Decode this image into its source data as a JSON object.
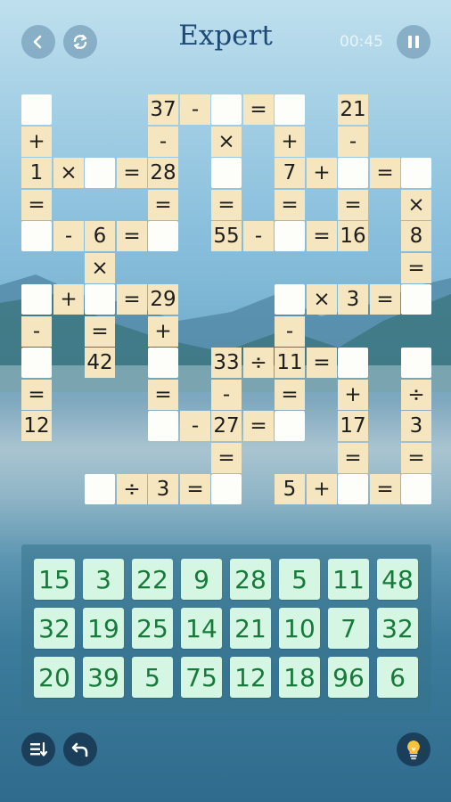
{
  "header": {
    "title": "Expert",
    "timer": "00:45",
    "back_icon": "chevron-left-icon",
    "restart_icon": "refresh-icon",
    "pause_icon": "pause-icon"
  },
  "board": {
    "cells": [
      {
        "id": "c_1_1",
        "t": "blank"
      },
      {
        "id": "c_2_1",
        "t": "op",
        "v": "+"
      },
      {
        "id": "c_3_1",
        "t": "num",
        "v": "1"
      },
      {
        "id": "c_3_2",
        "t": "op",
        "v": "×"
      },
      {
        "id": "c_3_3",
        "t": "blank"
      },
      {
        "id": "c_3_4",
        "t": "op",
        "v": "="
      },
      {
        "id": "c_3_5",
        "t": "num",
        "v": "28"
      },
      {
        "id": "c_1_5",
        "t": "num",
        "v": "37"
      },
      {
        "id": "c_1_6",
        "t": "op",
        "v": "-"
      },
      {
        "id": "c_1_7",
        "t": "blank"
      },
      {
        "id": "c_1_8",
        "t": "op",
        "v": "="
      },
      {
        "id": "c_1_9",
        "t": "blank"
      },
      {
        "id": "c_2_5",
        "t": "op",
        "v": "-"
      },
      {
        "id": "c_2_7",
        "t": "op",
        "v": "×"
      },
      {
        "id": "c_2_9",
        "t": "op",
        "v": "+"
      },
      {
        "id": "c_1_11",
        "t": "num",
        "v": "21"
      },
      {
        "id": "c_2_11",
        "t": "op",
        "v": "-"
      },
      {
        "id": "c_3_7",
        "t": "blank"
      },
      {
        "id": "c_3_9",
        "t": "num",
        "v": "7"
      },
      {
        "id": "c_3_10",
        "t": "op",
        "v": "+"
      },
      {
        "id": "c_3_11",
        "t": "blank"
      },
      {
        "id": "c_3_12",
        "t": "op",
        "v": "="
      },
      {
        "id": "c_3_13",
        "t": "blank"
      },
      {
        "id": "c_4_1",
        "t": "op",
        "v": "="
      },
      {
        "id": "c_4_5",
        "t": "op",
        "v": "="
      },
      {
        "id": "c_4_7",
        "t": "op",
        "v": "="
      },
      {
        "id": "c_4_9",
        "t": "op",
        "v": "="
      },
      {
        "id": "c_4_11",
        "t": "op",
        "v": "="
      },
      {
        "id": "c_4_13",
        "t": "op",
        "v": "×"
      },
      {
        "id": "c_5_1",
        "t": "blank"
      },
      {
        "id": "c_5_2",
        "t": "op",
        "v": "-"
      },
      {
        "id": "c_5_3",
        "t": "num",
        "v": "6"
      },
      {
        "id": "c_5_4",
        "t": "op",
        "v": "="
      },
      {
        "id": "c_5_5",
        "t": "blank"
      },
      {
        "id": "c_5_7",
        "t": "num",
        "v": "55"
      },
      {
        "id": "c_5_8",
        "t": "op",
        "v": "-"
      },
      {
        "id": "c_5_9",
        "t": "blank"
      },
      {
        "id": "c_5_10",
        "t": "op",
        "v": "="
      },
      {
        "id": "c_5_11",
        "t": "num",
        "v": "16"
      },
      {
        "id": "c_5_13",
        "t": "num",
        "v": "8"
      },
      {
        "id": "c_6_3",
        "t": "op",
        "v": "×"
      },
      {
        "id": "c_6_13",
        "t": "op",
        "v": "="
      },
      {
        "id": "c_7_1",
        "t": "blank"
      },
      {
        "id": "c_7_2",
        "t": "op",
        "v": "+"
      },
      {
        "id": "c_7_3",
        "t": "blank"
      },
      {
        "id": "c_7_4",
        "t": "op",
        "v": "="
      },
      {
        "id": "c_7_5",
        "t": "num",
        "v": "29"
      },
      {
        "id": "c_7_9",
        "t": "blank"
      },
      {
        "id": "c_7_10",
        "t": "op",
        "v": "×"
      },
      {
        "id": "c_7_11",
        "t": "num",
        "v": "3"
      },
      {
        "id": "c_7_12",
        "t": "op",
        "v": "="
      },
      {
        "id": "c_7_13",
        "t": "blank"
      },
      {
        "id": "c_8_1",
        "t": "op",
        "v": "-"
      },
      {
        "id": "c_8_3",
        "t": "op",
        "v": "="
      },
      {
        "id": "c_8_5",
        "t": "op",
        "v": "+"
      },
      {
        "id": "c_8_9",
        "t": "op",
        "v": "-"
      },
      {
        "id": "c_9_1",
        "t": "blank"
      },
      {
        "id": "c_9_3",
        "t": "num",
        "v": "42"
      },
      {
        "id": "c_9_5",
        "t": "blank"
      },
      {
        "id": "c_9_7",
        "t": "num",
        "v": "33"
      },
      {
        "id": "c_9_8",
        "t": "op",
        "v": "÷"
      },
      {
        "id": "c_9_9",
        "t": "num",
        "v": "11"
      },
      {
        "id": "c_9_10",
        "t": "op",
        "v": "="
      },
      {
        "id": "c_9_11",
        "t": "blank"
      },
      {
        "id": "c_9_13",
        "t": "blank"
      },
      {
        "id": "c_10_1",
        "t": "op",
        "v": "="
      },
      {
        "id": "c_10_5",
        "t": "op",
        "v": "="
      },
      {
        "id": "c_10_7",
        "t": "op",
        "v": "-"
      },
      {
        "id": "c_10_9",
        "t": "op",
        "v": "="
      },
      {
        "id": "c_10_11",
        "t": "op",
        "v": "+"
      },
      {
        "id": "c_10_13",
        "t": "op",
        "v": "÷"
      },
      {
        "id": "c_11_1",
        "t": "num",
        "v": "12"
      },
      {
        "id": "c_11_5",
        "t": "blank"
      },
      {
        "id": "c_11_6",
        "t": "op",
        "v": "-"
      },
      {
        "id": "c_11_7",
        "t": "num",
        "v": "27"
      },
      {
        "id": "c_11_8",
        "t": "op",
        "v": "="
      },
      {
        "id": "c_11_9",
        "t": "blank"
      },
      {
        "id": "c_11_11",
        "t": "num",
        "v": "17"
      },
      {
        "id": "c_11_13",
        "t": "num",
        "v": "3"
      },
      {
        "id": "c_12_7",
        "t": "op",
        "v": "="
      },
      {
        "id": "c_12_11",
        "t": "op",
        "v": "="
      },
      {
        "id": "c_12_13",
        "t": "op",
        "v": "="
      },
      {
        "id": "c_13_3",
        "t": "blank"
      },
      {
        "id": "c_13_4",
        "t": "op",
        "v": "÷"
      },
      {
        "id": "c_13_5",
        "t": "num",
        "v": "3"
      },
      {
        "id": "c_13_6",
        "t": "op",
        "v": "="
      },
      {
        "id": "c_13_7",
        "t": "blank"
      },
      {
        "id": "c_13_9",
        "t": "num",
        "v": "5"
      },
      {
        "id": "c_13_10",
        "t": "op",
        "v": "+"
      },
      {
        "id": "c_13_11",
        "t": "blank"
      },
      {
        "id": "c_13_12",
        "t": "op",
        "v": "="
      },
      {
        "id": "c_13_13",
        "t": "blank"
      }
    ]
  },
  "tray": {
    "tiles": [
      "15",
      "3",
      "22",
      "9",
      "28",
      "5",
      "11",
      "48",
      "32",
      "19",
      "25",
      "14",
      "21",
      "10",
      "7",
      "32",
      "20",
      "39",
      "5",
      "75",
      "12",
      "18",
      "96",
      "6"
    ]
  },
  "footer": {
    "list_icon": "sort-list-icon",
    "undo_icon": "undo-icon",
    "hint_icon": "lightbulb-icon"
  },
  "colors": {
    "number_cell": "#f5e6bf",
    "blank_cell": "#fdfdfa",
    "tile": "#d4f6e3",
    "tile_text": "#177a3a",
    "title": "#1f4a75"
  }
}
